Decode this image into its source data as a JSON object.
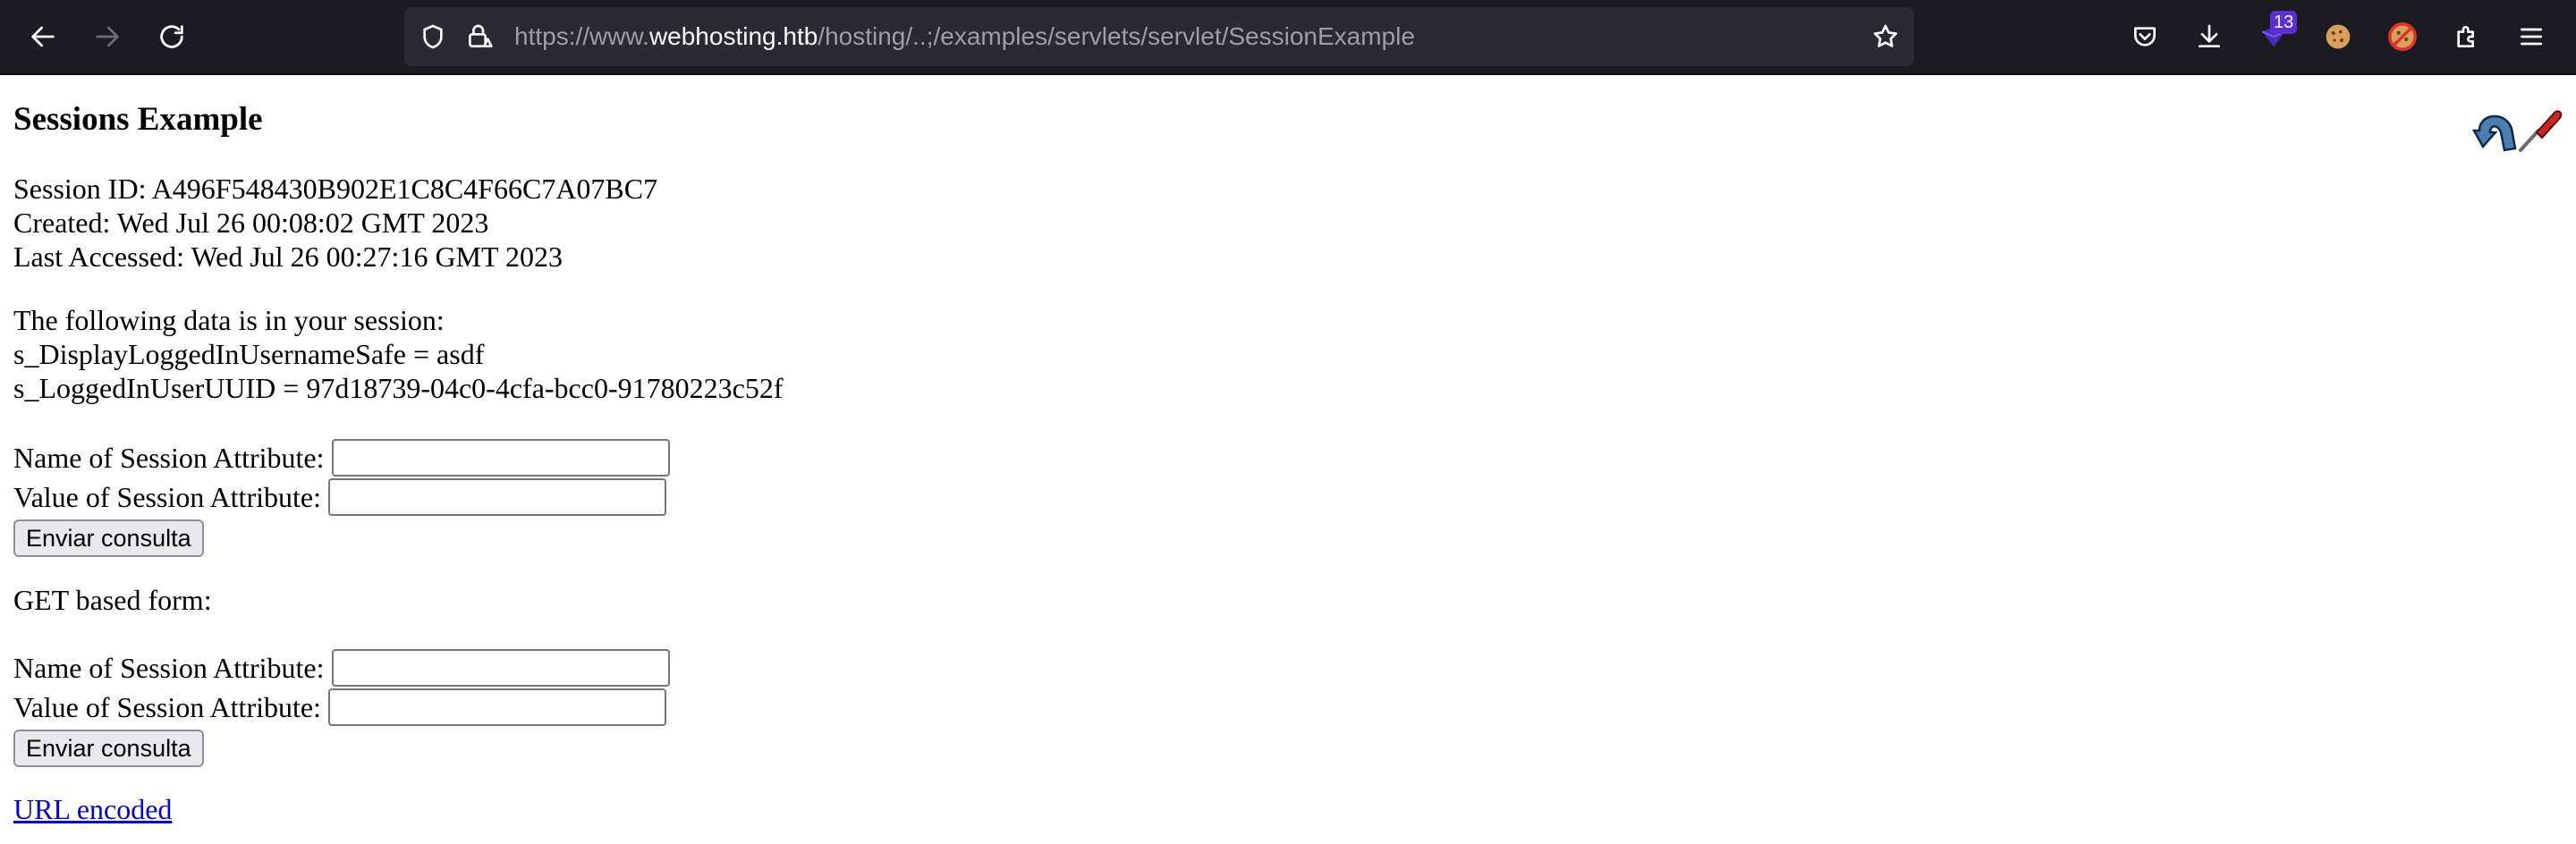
{
  "browser": {
    "url_prefix": "https://www.",
    "url_host": "webhosting.htb",
    "url_path": "/hosting/..;/examples/servlets/servlet/SessionExample",
    "extension_badge": "13",
    "icons": {
      "back": "arrow-left-icon",
      "forward": "arrow-right-icon",
      "reload": "reload-icon",
      "shield": "shield-icon",
      "lock": "lock-warning-icon",
      "bookmark": "star-icon",
      "pocket": "pocket-icon",
      "downloads": "download-icon",
      "extensions": "puzzle-icon",
      "menu": "hamburger-menu-icon"
    }
  },
  "page": {
    "title": "Sessions Example",
    "session_id": "Session ID: A496F548430B902E1C8C4F66C7A07BC7",
    "created": "Created: Wed Jul 26 00:08:02 GMT 2023",
    "last_accessed": "Last Accessed: Wed Jul 26 00:27:16 GMT 2023",
    "data_intro": "The following data is in your session:",
    "attributes": [
      "s_DisplayLoggedInUsernameSafe = asdf",
      "s_LoggedInUserUUID = 97d18739-04c0-4cfa-bcc0-91780223c52f"
    ],
    "post_form": {
      "name_label": "Name of Session Attribute:",
      "value_label": "Value of Session Attribute:",
      "name_value": "",
      "value_value": "",
      "submit_label": "Enviar consulta"
    },
    "get_form_heading": "GET based form:",
    "get_form": {
      "name_label": "Name of Session Attribute:",
      "value_label": "Value of Session Attribute:",
      "name_value": "",
      "value_value": "",
      "submit_label": "Enviar consulta"
    },
    "url_encoded_link": "URL encoded"
  },
  "colors": {
    "toolbar_bg": "#1c1b22",
    "urlbar_bg": "#2b2a33",
    "link": "#0000ee",
    "badge": "#5b2fd6"
  }
}
